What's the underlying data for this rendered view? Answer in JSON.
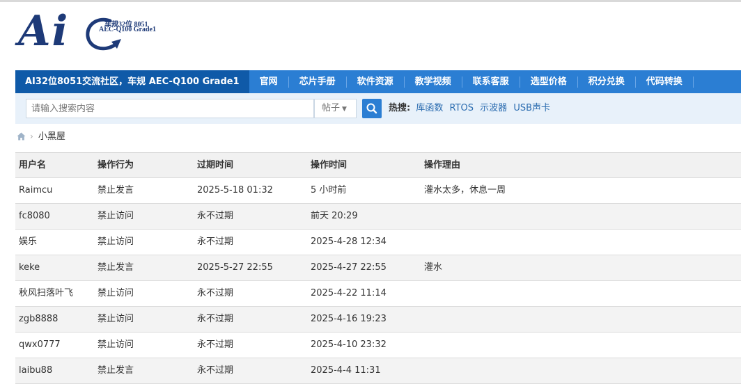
{
  "logo": {
    "letters": "Ai",
    "line1": "车规32位 8051",
    "line2": "AEC-Q100 Grade1"
  },
  "nav": {
    "site_title": "AI32位8051交流社区，车规 AEC-Q100 Grade1",
    "items": [
      "官网",
      "芯片手册",
      "软件资源",
      "教学视频",
      "联系客服",
      "选型价格",
      "积分兑换",
      "代码转换"
    ]
  },
  "search": {
    "placeholder": "请输入搜索内容",
    "type": "帖子",
    "hot_label": "热搜:",
    "hot_links": [
      "库函数",
      "RTOS",
      "示波器",
      "USB声卡"
    ]
  },
  "breadcrumb": {
    "current": "小黑屋"
  },
  "table": {
    "headers": [
      "用户名",
      "操作行为",
      "过期时间",
      "操作时间",
      "操作理由"
    ],
    "rows": [
      [
        "Raimcu",
        "禁止发言",
        "2025-5-18 01:32",
        "5 小时前",
        "灌水太多，休息一周"
      ],
      [
        "fc8080",
        "禁止访问",
        "永不过期",
        "前天 20:29",
        ""
      ],
      [
        "娱乐",
        "禁止访问",
        "永不过期",
        "2025-4-28 12:34",
        ""
      ],
      [
        "keke",
        "禁止发言",
        "2025-5-27 22:55",
        "2025-4-27 22:55",
        "灌水"
      ],
      [
        "秋风扫落叶飞",
        "禁止访问",
        "永不过期",
        "2025-4-22 11:14",
        ""
      ],
      [
        "zgb8888",
        "禁止访问",
        "永不过期",
        "2025-4-16 19:23",
        ""
      ],
      [
        "qwx0777",
        "禁止访问",
        "永不过期",
        "2025-4-10 23:32",
        ""
      ],
      [
        "laibu88",
        "禁止发言",
        "永不过期",
        "2025-4-4 11:31",
        ""
      ]
    ]
  }
}
